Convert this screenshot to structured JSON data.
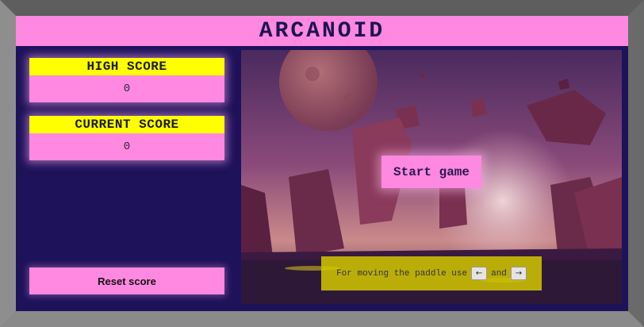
{
  "header": {
    "title": "ARCANOID"
  },
  "scores": {
    "high": {
      "label": "HIGH SCORE",
      "value": "0"
    },
    "current": {
      "label": "CURRENT SCORE",
      "value": "0"
    }
  },
  "controls": {
    "reset_label": "Reset score",
    "start_label": "Start game"
  },
  "hint": {
    "prefix": "For moving the paddle use",
    "left_key": "←",
    "joiner": "and",
    "right_key": "→"
  },
  "colors": {
    "frame": "#7b7b7b",
    "panel_bg": "#1e125a",
    "pink": "#ff88e0",
    "yellow": "#ffff00",
    "hint_bg": "#d2c800"
  }
}
